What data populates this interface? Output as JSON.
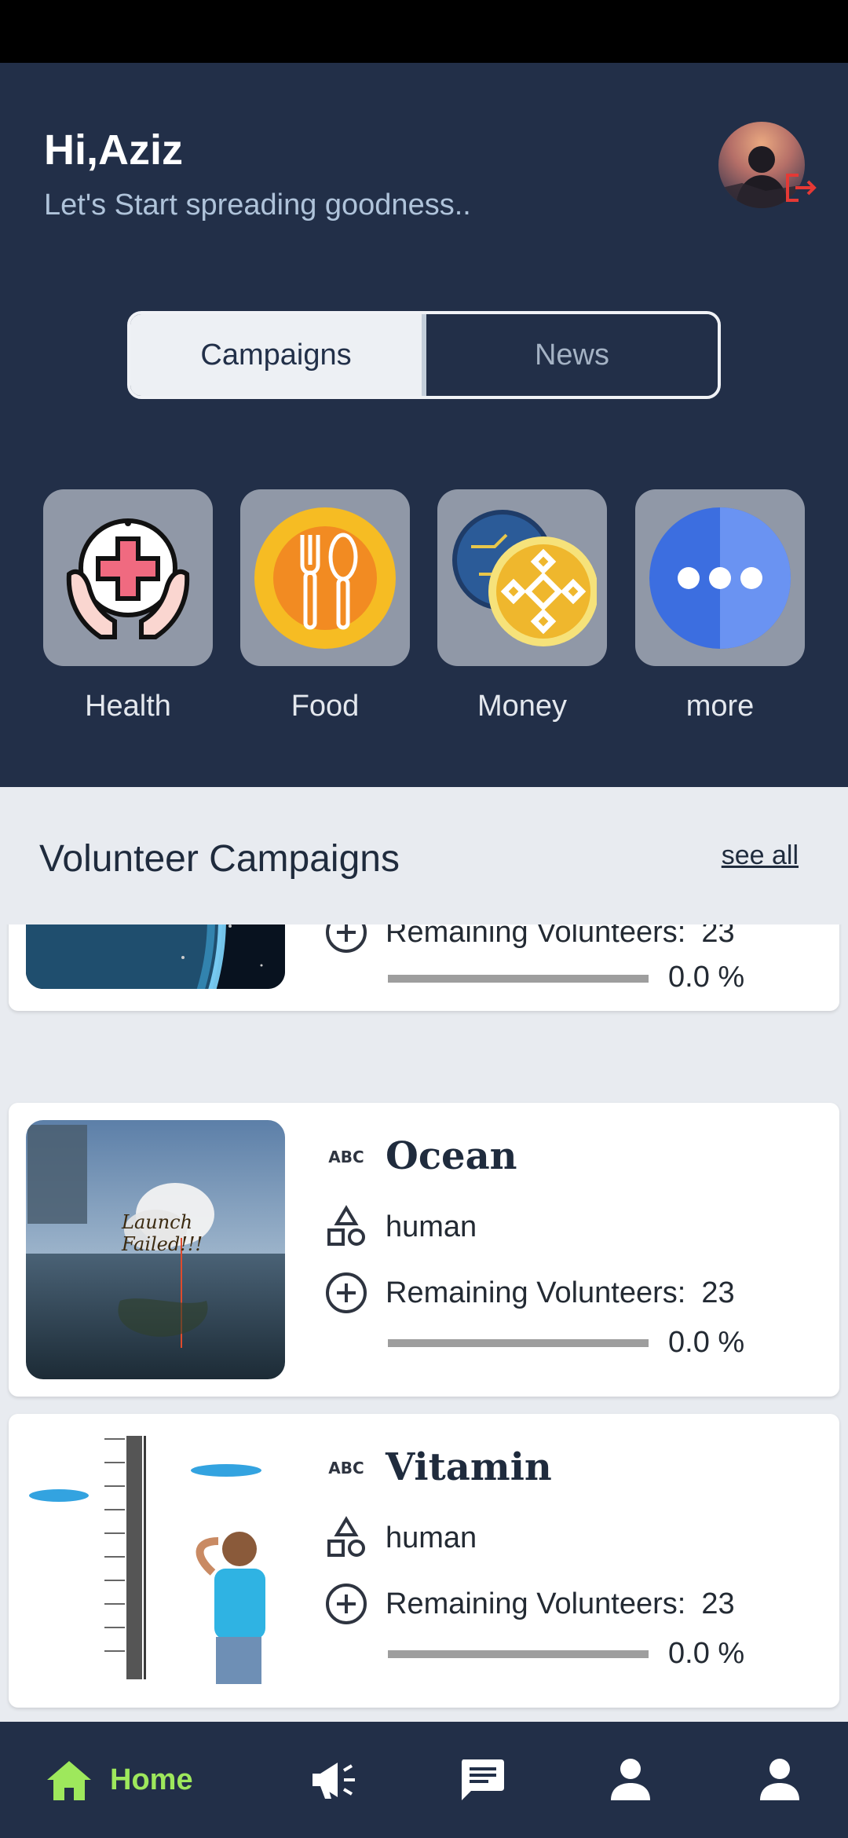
{
  "header": {
    "greeting": "Hi,Aziz",
    "subtitle": "Let's Start spreading goodness.."
  },
  "tabs": [
    {
      "label": "Campaigns",
      "selected": true
    },
    {
      "label": "News",
      "selected": false
    }
  ],
  "categories": [
    {
      "label": "Health",
      "icon": "health-hands-icon"
    },
    {
      "label": "Food",
      "icon": "fork-spoon-icon"
    },
    {
      "label": "Money",
      "icon": "coin-icon"
    },
    {
      "label": "more",
      "icon": "more-dots-icon"
    }
  ],
  "section": {
    "title": "Volunteer Campaigns",
    "see_all": "see all"
  },
  "campaigns": [
    {
      "title": "",
      "type": "",
      "remaining_label": "Remaining Volunteers:",
      "remaining": "23",
      "progress": 0.0,
      "progress_text": "0.0 %"
    },
    {
      "title": "Ocean",
      "type": "human",
      "remaining_label": "Remaining Volunteers:",
      "remaining": "23",
      "progress": 0.0,
      "progress_text": "0.0 %",
      "image_caption": "Launch Failed!!!"
    },
    {
      "title": "Vitamin",
      "type": "human",
      "remaining_label": "Remaining Volunteers:",
      "remaining": "23",
      "progress": 0.0,
      "progress_text": "0.0 %"
    }
  ],
  "bottom_nav": {
    "home_label": "Home",
    "active_color": "#9EE85C"
  },
  "colors": {
    "header_bg": "#222F48",
    "accent_logout": "#E53935"
  }
}
